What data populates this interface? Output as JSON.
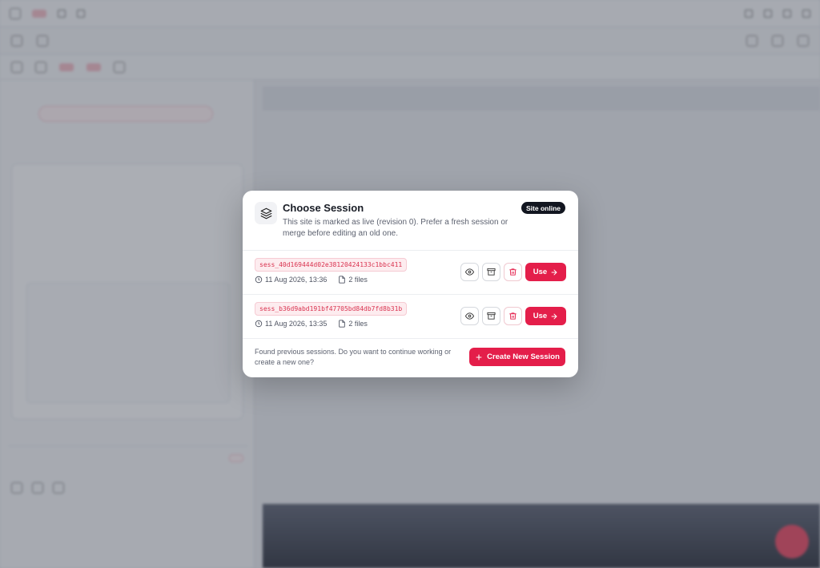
{
  "modal": {
    "title": "Choose Session",
    "description": "This site is marked as live (revision 0). Prefer a fresh session or merge before editing an old one.",
    "badge": "Site online",
    "sessions": [
      {
        "id": "sess_40d169444d02e38120424133c1bbc411",
        "date": "11 Aug 2026, 13:36",
        "files": "2 files",
        "use_label": "Use"
      },
      {
        "id": "sess_b36d9abd191bf47705bd84db7fd8b31b",
        "date": "11 Aug 2026, 13:35",
        "files": "2 files",
        "use_label": "Use"
      }
    ],
    "footer_text": "Found previous sessions. Do you want to continue working or create a new one?",
    "create_label": "Create New Session"
  },
  "colors": {
    "accent": "#e41e4a",
    "badge_bg": "#121620",
    "overlay": "rgba(60,66,80,0.42)"
  },
  "icons": {
    "modal": "layers-icon",
    "view": "eye-icon",
    "archive": "archive-icon",
    "delete": "trash-icon",
    "use": "arrow-right-icon",
    "clock": "clock-icon",
    "file": "file-icon",
    "create": "plus-icon"
  }
}
